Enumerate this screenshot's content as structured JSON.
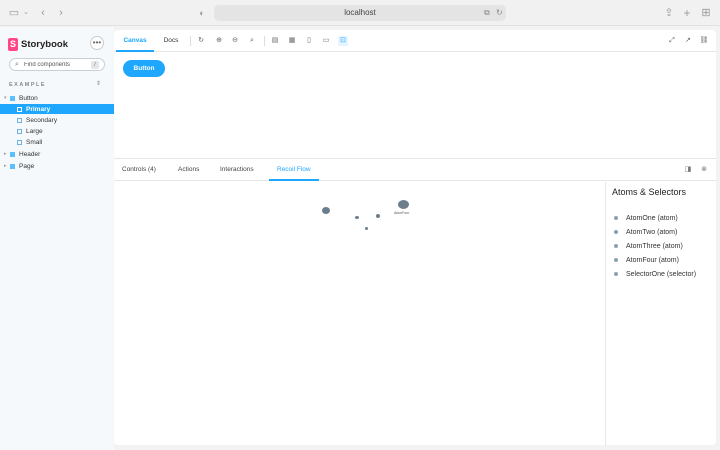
{
  "browser": {
    "url": "localhost"
  },
  "sidebar": {
    "brand": "Storybook",
    "logo_letter": "S",
    "search_placeholder": "Find components",
    "search_shortcut": "/",
    "section_title": "EXAMPLE",
    "tree": [
      {
        "label": "Button",
        "kind": "component"
      },
      {
        "label": "Primary",
        "kind": "story",
        "selected": true
      },
      {
        "label": "Secondary",
        "kind": "story"
      },
      {
        "label": "Large",
        "kind": "story"
      },
      {
        "label": "Small",
        "kind": "story"
      },
      {
        "label": "Header",
        "kind": "component"
      },
      {
        "label": "Page",
        "kind": "component"
      }
    ]
  },
  "toolbar": {
    "tabs": [
      "Canvas",
      "Docs"
    ],
    "active_tab": "Canvas"
  },
  "canvas": {
    "button_label": "Button"
  },
  "addons": {
    "tabs": [
      "Controls (4)",
      "Actions",
      "Interactions",
      "Recoil Flow"
    ],
    "active_tab": "Recoil Flow"
  },
  "recoil": {
    "panel_title": "Atoms & Selectors",
    "items": [
      "AtomOne (atom)",
      "AtomTwo (atom)",
      "AtomThree (atom)",
      "AtomFour (atom)",
      "SelectorOne (selector)"
    ],
    "graph_labels": [
      "AtomFour"
    ]
  },
  "colors": {
    "accent": "#1ea7fd",
    "brand": "#ff4785",
    "node": "#6c7e8b"
  }
}
